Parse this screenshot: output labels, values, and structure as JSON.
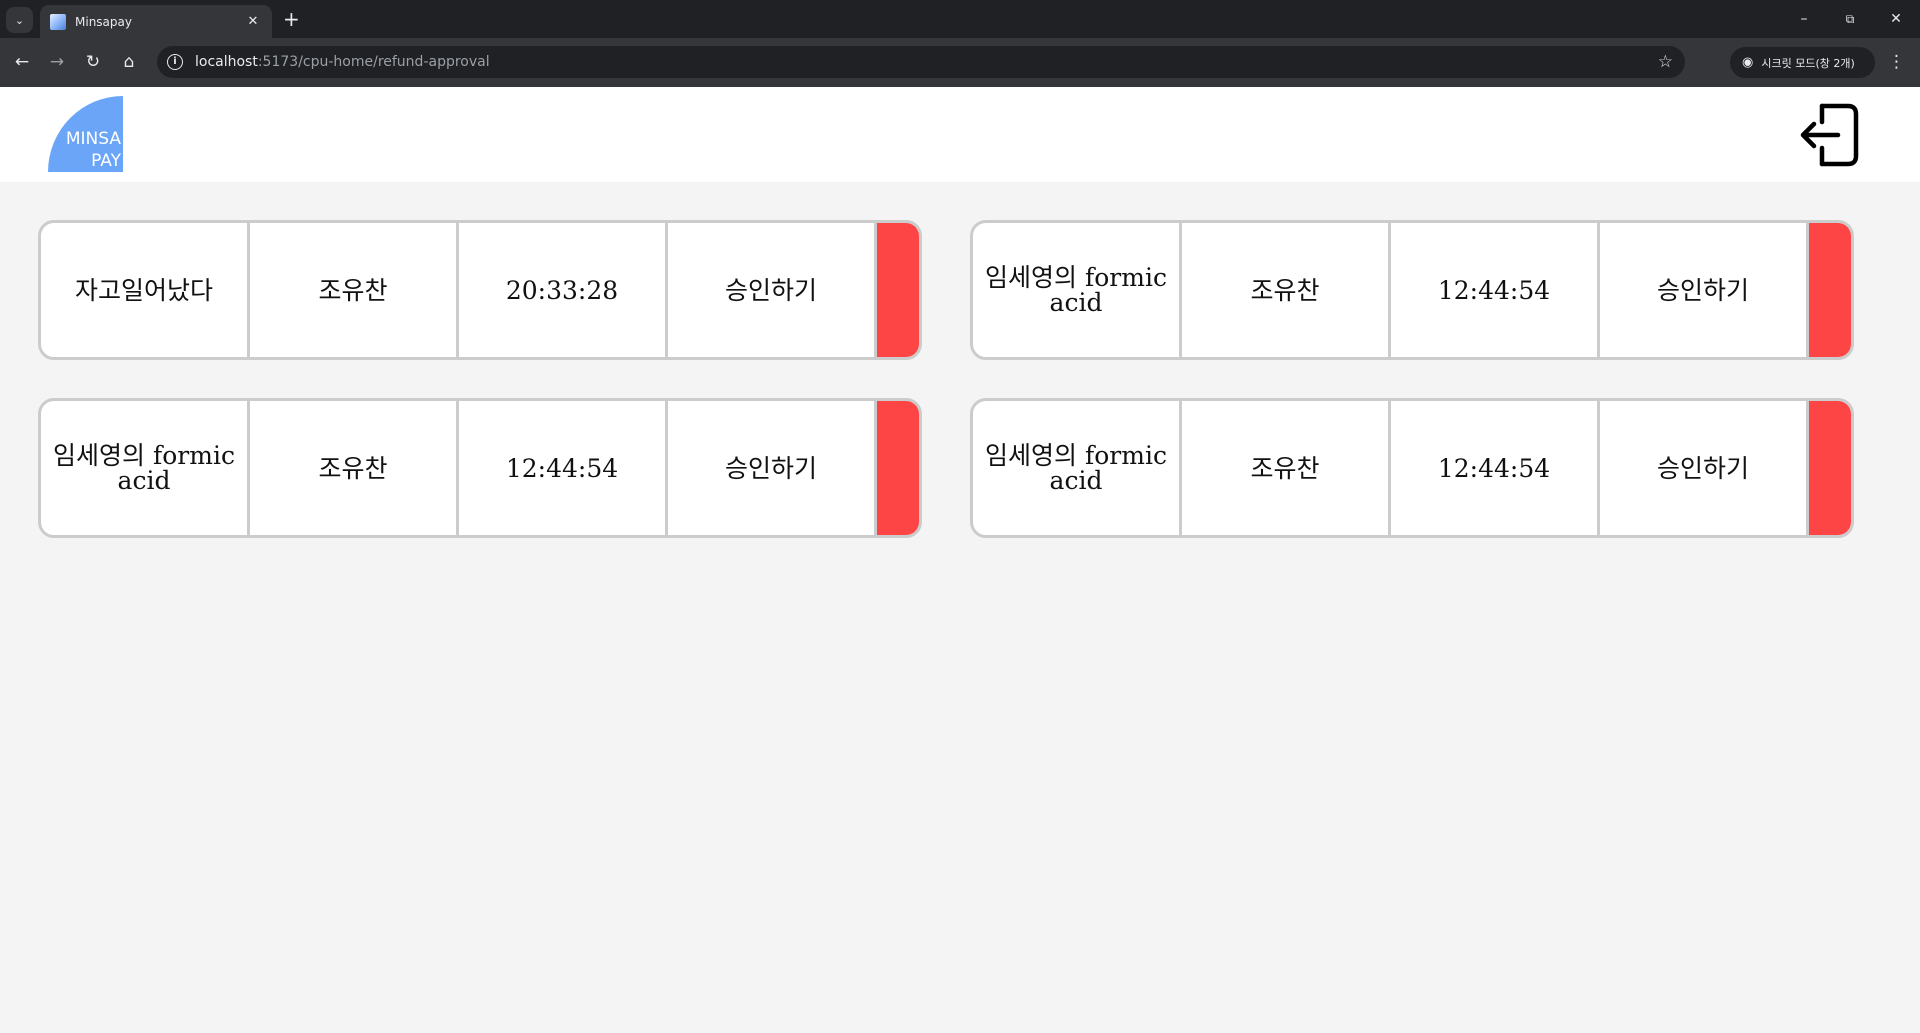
{
  "browser": {
    "tab_title": "Minsapay",
    "url_host": "localhost",
    "url_rest": ":5173/cpu-home/refund-approval",
    "incognito_label": "시크릿 모드(창 2개)"
  },
  "app": {
    "logo_line1": "MINSA",
    "logo_line2": "PAY",
    "logo_color": "#6aa5f8",
    "deny_color": "#fe4545"
  },
  "requests": [
    {
      "item": "자고일어났다",
      "name": "조유찬",
      "time": "20:33:28",
      "action": "승인하기"
    },
    {
      "item": "임세영의 formic acid",
      "name": "조유찬",
      "time": "12:44:54",
      "action": "승인하기"
    },
    {
      "item": "임세영의 formic acid",
      "name": "조유찬",
      "time": "12:44:54",
      "action": "승인하기"
    },
    {
      "item": "임세영의 formic acid",
      "name": "조유찬",
      "time": "12:44:54",
      "action": "승인하기"
    }
  ]
}
